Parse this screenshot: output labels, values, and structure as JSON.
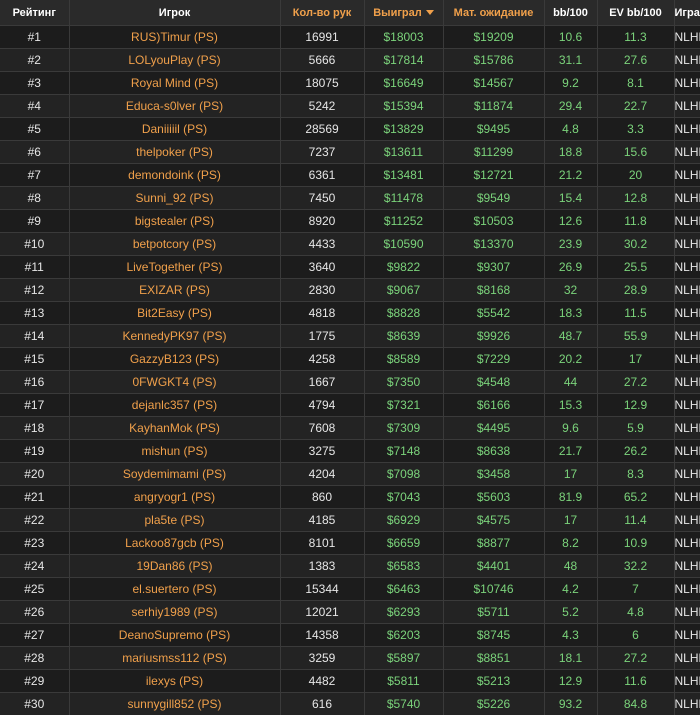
{
  "colors": {
    "link": "#f0a04b",
    "positive": "#7bd37b",
    "text": "#e6e6e6",
    "header_bg": "#2a2a2a"
  },
  "headers": {
    "rank": "Рейтинг",
    "player": "Игрок",
    "hands": "Кол-во рук",
    "won": "Выиграл",
    "ev": "Мат. ожидание",
    "bb100": "bb/100",
    "evbb100": "EV bb/100",
    "game": "Игра"
  },
  "sort": {
    "column": "won",
    "direction": "desc",
    "icon": "caret-down-icon"
  },
  "rows": [
    {
      "rank": "#1",
      "player": "RUS)Timur (PS)",
      "hands": "16991",
      "won": "$18003",
      "ev": "$19209",
      "bb100": "10.6",
      "evbb100": "11.3",
      "game": "NLHE"
    },
    {
      "rank": "#2",
      "player": "LOLyouPlay (PS)",
      "hands": "5666",
      "won": "$17814",
      "ev": "$15786",
      "bb100": "31.1",
      "evbb100": "27.6",
      "game": "NLHE"
    },
    {
      "rank": "#3",
      "player": "Royal Mind (PS)",
      "hands": "18075",
      "won": "$16649",
      "ev": "$14567",
      "bb100": "9.2",
      "evbb100": "8.1",
      "game": "NLHE"
    },
    {
      "rank": "#4",
      "player": "Educa-s0lver (PS)",
      "hands": "5242",
      "won": "$15394",
      "ev": "$11874",
      "bb100": "29.4",
      "evbb100": "22.7",
      "game": "NLHE"
    },
    {
      "rank": "#5",
      "player": "Daniiiiil (PS)",
      "hands": "28569",
      "won": "$13829",
      "ev": "$9495",
      "bb100": "4.8",
      "evbb100": "3.3",
      "game": "NLHE"
    },
    {
      "rank": "#6",
      "player": "thelpoker (PS)",
      "hands": "7237",
      "won": "$13611",
      "ev": "$11299",
      "bb100": "18.8",
      "evbb100": "15.6",
      "game": "NLHE"
    },
    {
      "rank": "#7",
      "player": "demondoink (PS)",
      "hands": "6361",
      "won": "$13481",
      "ev": "$12721",
      "bb100": "21.2",
      "evbb100": "20",
      "game": "NLHE"
    },
    {
      "rank": "#8",
      "player": "Sunni_92 (PS)",
      "hands": "7450",
      "won": "$11478",
      "ev": "$9549",
      "bb100": "15.4",
      "evbb100": "12.8",
      "game": "NLHE"
    },
    {
      "rank": "#9",
      "player": "bigstealer (PS)",
      "hands": "8920",
      "won": "$11252",
      "ev": "$10503",
      "bb100": "12.6",
      "evbb100": "11.8",
      "game": "NLHE"
    },
    {
      "rank": "#10",
      "player": "betpotcory (PS)",
      "hands": "4433",
      "won": "$10590",
      "ev": "$13370",
      "bb100": "23.9",
      "evbb100": "30.2",
      "game": "NLHE"
    },
    {
      "rank": "#11",
      "player": "LiveTogether (PS)",
      "hands": "3640",
      "won": "$9822",
      "ev": "$9307",
      "bb100": "26.9",
      "evbb100": "25.5",
      "game": "NLHE"
    },
    {
      "rank": "#12",
      "player": "EXIZAR (PS)",
      "hands": "2830",
      "won": "$9067",
      "ev": "$8168",
      "bb100": "32",
      "evbb100": "28.9",
      "game": "NLHE"
    },
    {
      "rank": "#13",
      "player": "Bit2Easy (PS)",
      "hands": "4818",
      "won": "$8828",
      "ev": "$5542",
      "bb100": "18.3",
      "evbb100": "11.5",
      "game": "NLHE"
    },
    {
      "rank": "#14",
      "player": "KennedyPK97 (PS)",
      "hands": "1775",
      "won": "$8639",
      "ev": "$9926",
      "bb100": "48.7",
      "evbb100": "55.9",
      "game": "NLHE"
    },
    {
      "rank": "#15",
      "player": "GazzyB123 (PS)",
      "hands": "4258",
      "won": "$8589",
      "ev": "$7229",
      "bb100": "20.2",
      "evbb100": "17",
      "game": "NLHE"
    },
    {
      "rank": "#16",
      "player": "0FWGKT4 (PS)",
      "hands": "1667",
      "won": "$7350",
      "ev": "$4548",
      "bb100": "44",
      "evbb100": "27.2",
      "game": "NLHE"
    },
    {
      "rank": "#17",
      "player": "dejanlc357 (PS)",
      "hands": "4794",
      "won": "$7321",
      "ev": "$6166",
      "bb100": "15.3",
      "evbb100": "12.9",
      "game": "NLHE"
    },
    {
      "rank": "#18",
      "player": "KayhanMok (PS)",
      "hands": "7608",
      "won": "$7309",
      "ev": "$4495",
      "bb100": "9.6",
      "evbb100": "5.9",
      "game": "NLHE"
    },
    {
      "rank": "#19",
      "player": "mishun (PS)",
      "hands": "3275",
      "won": "$7148",
      "ev": "$8638",
      "bb100": "21.7",
      "evbb100": "26.2",
      "game": "NLHE"
    },
    {
      "rank": "#20",
      "player": "Soydemimami (PS)",
      "hands": "4204",
      "won": "$7098",
      "ev": "$3458",
      "bb100": "17",
      "evbb100": "8.3",
      "game": "NLHE"
    },
    {
      "rank": "#21",
      "player": "angryogr1 (PS)",
      "hands": "860",
      "won": "$7043",
      "ev": "$5603",
      "bb100": "81.9",
      "evbb100": "65.2",
      "game": "NLHE"
    },
    {
      "rank": "#22",
      "player": "pla5te (PS)",
      "hands": "4185",
      "won": "$6929",
      "ev": "$4575",
      "bb100": "17",
      "evbb100": "11.4",
      "game": "NLHE"
    },
    {
      "rank": "#23",
      "player": "Lackoo87gcb (PS)",
      "hands": "8101",
      "won": "$6659",
      "ev": "$8877",
      "bb100": "8.2",
      "evbb100": "10.9",
      "game": "NLHE"
    },
    {
      "rank": "#24",
      "player": "19Dan86 (PS)",
      "hands": "1383",
      "won": "$6583",
      "ev": "$4401",
      "bb100": "48",
      "evbb100": "32.2",
      "game": "NLHE"
    },
    {
      "rank": "#25",
      "player": "el.suertero (PS)",
      "hands": "15344",
      "won": "$6463",
      "ev": "$10746",
      "bb100": "4.2",
      "evbb100": "7",
      "game": "NLHE"
    },
    {
      "rank": "#26",
      "player": "serhiy1989 (PS)",
      "hands": "12021",
      "won": "$6293",
      "ev": "$5711",
      "bb100": "5.2",
      "evbb100": "4.8",
      "game": "NLHE"
    },
    {
      "rank": "#27",
      "player": "DeanoSupremo (PS)",
      "hands": "14358",
      "won": "$6203",
      "ev": "$8745",
      "bb100": "4.3",
      "evbb100": "6",
      "game": "NLHE"
    },
    {
      "rank": "#28",
      "player": "mariusmss112 (PS)",
      "hands": "3259",
      "won": "$5897",
      "ev": "$8851",
      "bb100": "18.1",
      "evbb100": "27.2",
      "game": "NLHE"
    },
    {
      "rank": "#29",
      "player": "ilexys (PS)",
      "hands": "4482",
      "won": "$5811",
      "ev": "$5213",
      "bb100": "12.9",
      "evbb100": "11.6",
      "game": "NLHE"
    },
    {
      "rank": "#30",
      "player": "sunnygill852 (PS)",
      "hands": "616",
      "won": "$5740",
      "ev": "$5226",
      "bb100": "93.2",
      "evbb100": "84.8",
      "game": "NLHE"
    }
  ]
}
